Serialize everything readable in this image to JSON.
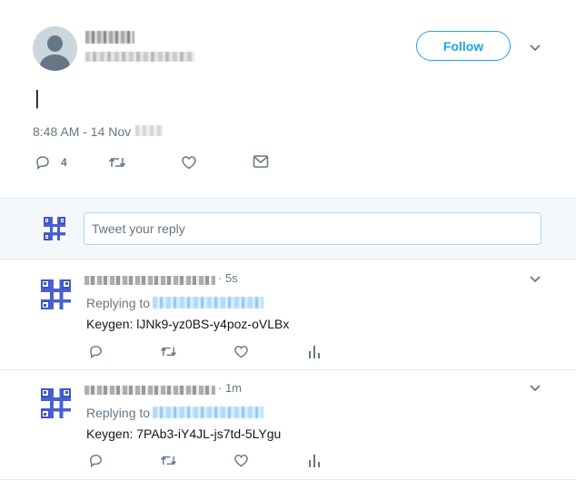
{
  "tweet": {
    "author_name": "[blurred name]",
    "author_handle": "[blurred handle]",
    "follow_label": "Follow",
    "body": "|",
    "timestamp": "8:48 AM - 14 Nov",
    "reply_count": "4"
  },
  "reply_box": {
    "placeholder": "Tweet your reply"
  },
  "replies": [
    {
      "time": "· 5s",
      "replying_to_label": "Replying to",
      "text": "Keygen: lJNk9-yz0BS-y4poz-oVLBx"
    },
    {
      "time": "· 1m",
      "replying_to_label": "Replying to",
      "text": "Keygen: 7PAb3-iY4JL-js7td-5LYgu"
    }
  ],
  "colors": {
    "accent": "#1da1f2",
    "secondary_text": "#657786",
    "qr": "#3d54c9"
  },
  "icons": [
    "reply-icon",
    "retweet-icon",
    "like-icon",
    "message-icon",
    "analytics-icon",
    "chevron-down-icon"
  ]
}
